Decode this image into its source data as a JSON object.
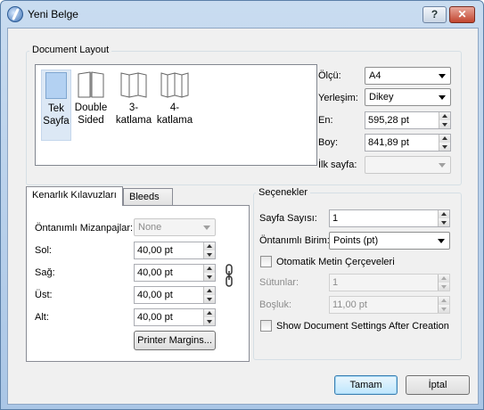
{
  "window": {
    "title": "Yeni Belge",
    "help_label": "?",
    "close_label": "✕"
  },
  "document_layout": {
    "group_title": "Document Layout",
    "items": [
      {
        "line1": "Tek",
        "line2": "Sayfa"
      },
      {
        "line1": "Double",
        "line2": "Sided"
      },
      {
        "line1": "3-",
        "line2": "katlama"
      },
      {
        "line1": "4-",
        "line2": "katlama"
      }
    ],
    "olcu_label": "Ölçü:",
    "olcu_value": "A4",
    "yerlesim_label": "Yerleşim:",
    "yerlesim_value": "Dikey",
    "en_label": "En:",
    "en_value": "595,28 pt",
    "boy_label": "Boy:",
    "boy_value": "841,89 pt",
    "ilk_sayfa_label": "İlk sayfa:",
    "ilk_sayfa_value": ""
  },
  "tabs": [
    {
      "label": "Kenarlık Kılavuzları"
    },
    {
      "label": "Bleeds"
    }
  ],
  "margins": {
    "preset_label": "Öntanımlı Mizanpajlar:",
    "preset_value": "None",
    "sol_label": "Sol:",
    "sol_value": "40,00 pt",
    "sag_label": "Sağ:",
    "sag_value": "40,00 pt",
    "ust_label": "Üst:",
    "ust_value": "40,00 pt",
    "alt_label": "Alt:",
    "alt_value": "40,00 pt",
    "printer_margins_label": "Printer Margins..."
  },
  "options": {
    "group_title": "Seçenekler",
    "sayfa_sayisi_label": "Sayfa Sayısı:",
    "sayfa_sayisi_value": "1",
    "birim_label": "Öntanımlı Birim:",
    "birim_value": "Points (pt)",
    "otomatik_label": "Otomatik Metin Çerçeveleri",
    "sutunlar_label": "Sütunlar:",
    "sutunlar_value": "1",
    "bosluk_label": "Boşluk:",
    "bosluk_value": "11,00 pt",
    "show_settings_label": "Show Document Settings After Creation"
  },
  "buttons": {
    "ok_label": "Tamam",
    "cancel_label": "İptal"
  }
}
